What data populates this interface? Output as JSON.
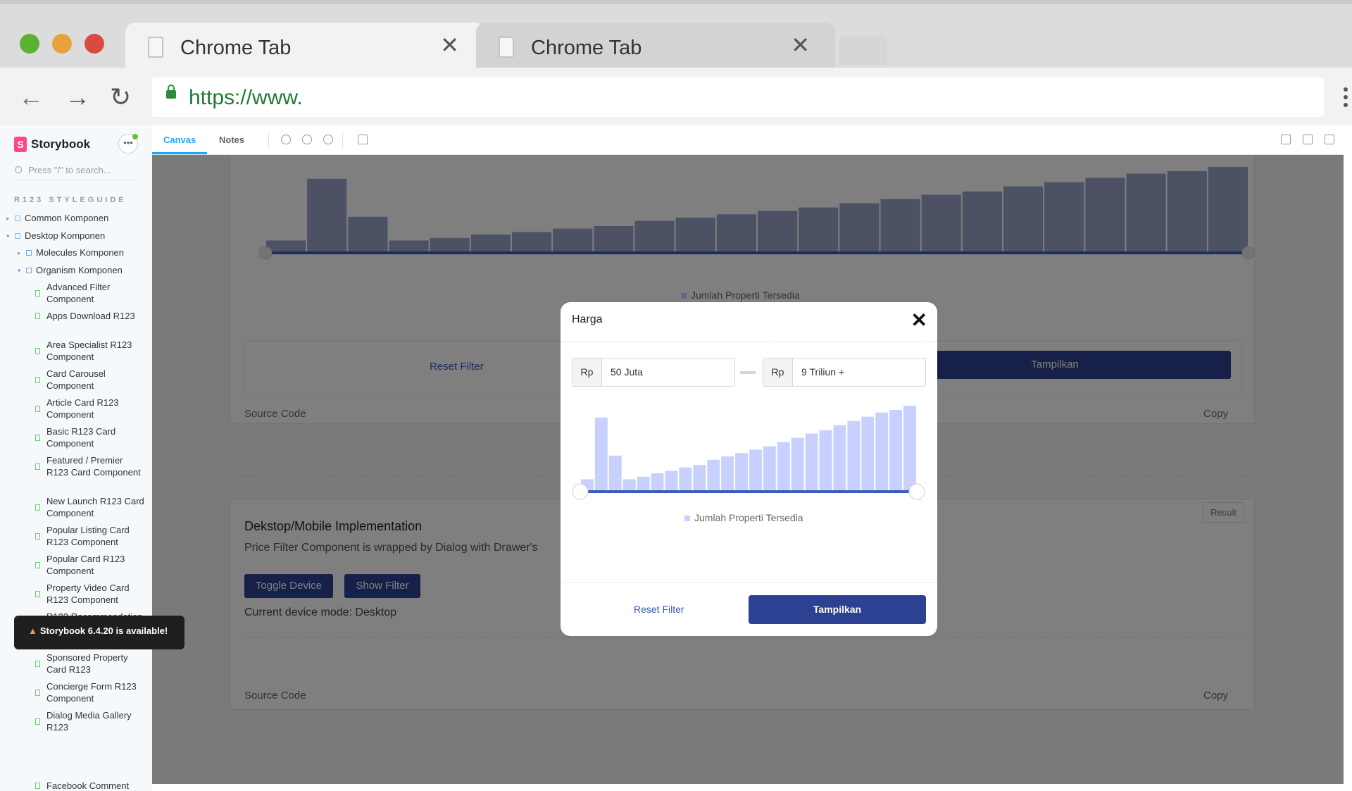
{
  "window": {
    "tabs": [
      {
        "title": "Chrome Tab",
        "active": true
      },
      {
        "title": "Chrome Tab",
        "active": false
      }
    ],
    "url": "https://www."
  },
  "storybook": {
    "brand": "Storybook",
    "search_placeholder": "Press \"/\" to search...",
    "section": "R123 STYLEGUIDE",
    "tree": {
      "common": "Common Komponen",
      "desktop": "Desktop Komponen",
      "molecules": "Molecules Komponen",
      "organism": "Organism Komponen"
    },
    "stories": [
      "Advanced Filter Component",
      "Apps Download R123",
      "Area Specialist R123 Component",
      "Card Carousel Component",
      "Article Card R123 Component",
      "Basic R123 Card Component",
      "Featured / Premier R123 Card Component",
      "New Launch R123 Card Component",
      "Popular Listing Card R123 Component",
      "Popular Card R123 Component",
      "Property Video Card R123 Component",
      "R123 Recommendation Card Component",
      "Sponsored Property Card R123",
      "Concierge Form R123 Component",
      "Dialog Media Gallery R123",
      "Facebook Comment"
    ],
    "toast": "Storybook 6.4.20 is available!",
    "tabs": {
      "canvas": "Canvas",
      "notes": "Notes"
    }
  },
  "docs": {
    "bg_legend": "Jumlah Properti Tersedia",
    "bg_reset": "Reset Filter",
    "bg_apply": "Tampilkan",
    "source_code": "Source Code",
    "copy": "Copy",
    "result": "Result",
    "impl_title": "Dekstop/Mobile Implementation",
    "impl_desc": "Price Filter Component is wrapped by Dialog with Drawer's",
    "toggle_device": "Toggle Device",
    "show_filter": "Show Filter",
    "device_mode": "Current device mode: Desktop"
  },
  "dialog": {
    "title": "Harga",
    "min_prefix": "Rp",
    "min_value": "50 Juta",
    "max_prefix": "Rp",
    "max_value": "9 Triliun +",
    "legend": "Jumlah Properti Tersedia",
    "reset": "Reset Filter",
    "apply": "Tampilkan",
    "slider": {
      "min_fraction": 0.0,
      "max_fraction": 1.0
    }
  },
  "chart_data": {
    "type": "bar",
    "title": "",
    "xlabel": "",
    "ylabel": "",
    "series": [
      {
        "name": "Jumlah Properti Tersedia",
        "values": [
          13,
          86,
          41,
          13,
          16,
          20,
          23,
          27,
          30,
          36,
          40,
          44,
          48,
          52,
          57,
          62,
          67,
          71,
          77,
          82,
          87,
          92,
          95,
          100
        ]
      }
    ],
    "colors": {
      "bar": "#c8d0ff",
      "track": "#3a5bb8"
    }
  },
  "colors": {
    "primary": "#2c4191",
    "link": "#3a5bb8",
    "storybook_accent": "#1ea7fd",
    "storybook_brand": "#ff4785"
  },
  "icons": [
    "back-arrow-icon",
    "forward-arrow-icon",
    "reload-icon",
    "lock-icon",
    "close-icon",
    "search-icon",
    "zoom-in-icon",
    "zoom-out-icon",
    "reset-zoom-icon",
    "outline-icon",
    "fullscreen-icon",
    "share-icon",
    "copy-link-icon"
  ]
}
